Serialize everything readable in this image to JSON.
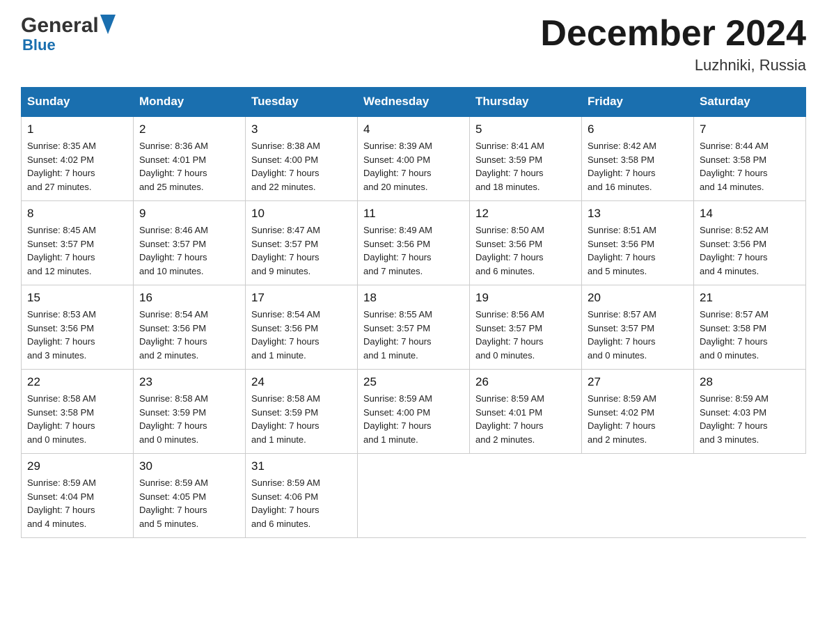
{
  "header": {
    "logo": {
      "general": "General",
      "blue": "Blue"
    },
    "title": "December 2024",
    "location": "Luzhniki, Russia"
  },
  "days_of_week": [
    "Sunday",
    "Monday",
    "Tuesday",
    "Wednesday",
    "Thursday",
    "Friday",
    "Saturday"
  ],
  "weeks": [
    [
      {
        "day": "1",
        "sunrise": "8:35 AM",
        "sunset": "4:02 PM",
        "daylight": "7 hours and 27 minutes."
      },
      {
        "day": "2",
        "sunrise": "8:36 AM",
        "sunset": "4:01 PM",
        "daylight": "7 hours and 25 minutes."
      },
      {
        "day": "3",
        "sunrise": "8:38 AM",
        "sunset": "4:00 PM",
        "daylight": "7 hours and 22 minutes."
      },
      {
        "day": "4",
        "sunrise": "8:39 AM",
        "sunset": "4:00 PM",
        "daylight": "7 hours and 20 minutes."
      },
      {
        "day": "5",
        "sunrise": "8:41 AM",
        "sunset": "3:59 PM",
        "daylight": "7 hours and 18 minutes."
      },
      {
        "day": "6",
        "sunrise": "8:42 AM",
        "sunset": "3:58 PM",
        "daylight": "7 hours and 16 minutes."
      },
      {
        "day": "7",
        "sunrise": "8:44 AM",
        "sunset": "3:58 PM",
        "daylight": "7 hours and 14 minutes."
      }
    ],
    [
      {
        "day": "8",
        "sunrise": "8:45 AM",
        "sunset": "3:57 PM",
        "daylight": "7 hours and 12 minutes."
      },
      {
        "day": "9",
        "sunrise": "8:46 AM",
        "sunset": "3:57 PM",
        "daylight": "7 hours and 10 minutes."
      },
      {
        "day": "10",
        "sunrise": "8:47 AM",
        "sunset": "3:57 PM",
        "daylight": "7 hours and 9 minutes."
      },
      {
        "day": "11",
        "sunrise": "8:49 AM",
        "sunset": "3:56 PM",
        "daylight": "7 hours and 7 minutes."
      },
      {
        "day": "12",
        "sunrise": "8:50 AM",
        "sunset": "3:56 PM",
        "daylight": "7 hours and 6 minutes."
      },
      {
        "day": "13",
        "sunrise": "8:51 AM",
        "sunset": "3:56 PM",
        "daylight": "7 hours and 5 minutes."
      },
      {
        "day": "14",
        "sunrise": "8:52 AM",
        "sunset": "3:56 PM",
        "daylight": "7 hours and 4 minutes."
      }
    ],
    [
      {
        "day": "15",
        "sunrise": "8:53 AM",
        "sunset": "3:56 PM",
        "daylight": "7 hours and 3 minutes."
      },
      {
        "day": "16",
        "sunrise": "8:54 AM",
        "sunset": "3:56 PM",
        "daylight": "7 hours and 2 minutes."
      },
      {
        "day": "17",
        "sunrise": "8:54 AM",
        "sunset": "3:56 PM",
        "daylight": "7 hours and 1 minute."
      },
      {
        "day": "18",
        "sunrise": "8:55 AM",
        "sunset": "3:57 PM",
        "daylight": "7 hours and 1 minute."
      },
      {
        "day": "19",
        "sunrise": "8:56 AM",
        "sunset": "3:57 PM",
        "daylight": "7 hours and 0 minutes."
      },
      {
        "day": "20",
        "sunrise": "8:57 AM",
        "sunset": "3:57 PM",
        "daylight": "7 hours and 0 minutes."
      },
      {
        "day": "21",
        "sunrise": "8:57 AM",
        "sunset": "3:58 PM",
        "daylight": "7 hours and 0 minutes."
      }
    ],
    [
      {
        "day": "22",
        "sunrise": "8:58 AM",
        "sunset": "3:58 PM",
        "daylight": "7 hours and 0 minutes."
      },
      {
        "day": "23",
        "sunrise": "8:58 AM",
        "sunset": "3:59 PM",
        "daylight": "7 hours and 0 minutes."
      },
      {
        "day": "24",
        "sunrise": "8:58 AM",
        "sunset": "3:59 PM",
        "daylight": "7 hours and 1 minute."
      },
      {
        "day": "25",
        "sunrise": "8:59 AM",
        "sunset": "4:00 PM",
        "daylight": "7 hours and 1 minute."
      },
      {
        "day": "26",
        "sunrise": "8:59 AM",
        "sunset": "4:01 PM",
        "daylight": "7 hours and 2 minutes."
      },
      {
        "day": "27",
        "sunrise": "8:59 AM",
        "sunset": "4:02 PM",
        "daylight": "7 hours and 2 minutes."
      },
      {
        "day": "28",
        "sunrise": "8:59 AM",
        "sunset": "4:03 PM",
        "daylight": "7 hours and 3 minutes."
      }
    ],
    [
      {
        "day": "29",
        "sunrise": "8:59 AM",
        "sunset": "4:04 PM",
        "daylight": "7 hours and 4 minutes."
      },
      {
        "day": "30",
        "sunrise": "8:59 AM",
        "sunset": "4:05 PM",
        "daylight": "7 hours and 5 minutes."
      },
      {
        "day": "31",
        "sunrise": "8:59 AM",
        "sunset": "4:06 PM",
        "daylight": "7 hours and 6 minutes."
      },
      null,
      null,
      null,
      null
    ]
  ],
  "labels": {
    "sunrise": "Sunrise:",
    "sunset": "Sunset:",
    "daylight": "Daylight:"
  }
}
